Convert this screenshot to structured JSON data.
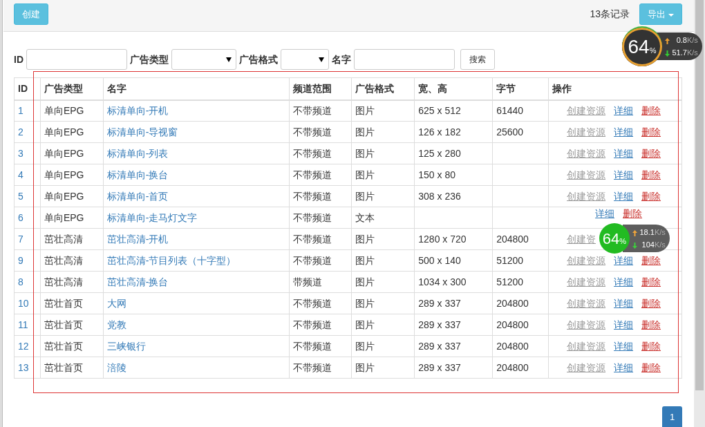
{
  "toolbar": {
    "create_button": "创建",
    "record_count": "13条记录",
    "export_button": "导出"
  },
  "filters": [
    {
      "kind": "text",
      "label": "ID"
    },
    {
      "kind": "select",
      "label": "广告类型"
    },
    {
      "kind": "select",
      "label": "广告格式"
    },
    {
      "kind": "text",
      "label": "名字"
    }
  ],
  "search_button": "搜索",
  "table": {
    "columns": [
      "ID",
      "广告类型",
      "名字",
      "频道范围",
      "广告格式",
      "宽、高",
      "字节",
      "操作"
    ],
    "rows": [
      {
        "id": "1",
        "type": "单向EPG",
        "name": "标清单向-开机",
        "channel": "不带频道",
        "format": "图片",
        "size": "625 x 512",
        "bytes": "61440",
        "actions": [
          {
            "kind": "create",
            "label": "创建资源"
          },
          {
            "kind": "detail",
            "label": "详细"
          },
          {
            "kind": "delete",
            "label": "删除"
          }
        ]
      },
      {
        "id": "2",
        "type": "单向EPG",
        "name": "标清单向-导视窗",
        "channel": "不带频道",
        "format": "图片",
        "size": "126 x 182",
        "bytes": "25600",
        "actions": [
          {
            "kind": "create",
            "label": "创建资源"
          },
          {
            "kind": "detail",
            "label": "详细"
          },
          {
            "kind": "delete",
            "label": "删除"
          }
        ]
      },
      {
        "id": "3",
        "type": "单向EPG",
        "name": "标清单向-列表",
        "channel": "不带频道",
        "format": "图片",
        "size": "125 x 280",
        "actions": [
          {
            "kind": "create",
            "label": "创建资源"
          },
          {
            "kind": "detail",
            "label": "详细"
          },
          {
            "kind": "delete",
            "label": "删除"
          }
        ]
      },
      {
        "id": "4",
        "type": "单向EPG",
        "name": "标清单向-换台",
        "channel": "不带频道",
        "format": "图片",
        "size": "150 x 80",
        "actions": [
          {
            "kind": "create",
            "label": "创建资源"
          },
          {
            "kind": "detail",
            "label": "详细"
          },
          {
            "kind": "delete",
            "label": "删除"
          }
        ]
      },
      {
        "id": "5",
        "type": "单向EPG",
        "name": "标清单向-首页",
        "channel": "不带频道",
        "format": "图片",
        "size": "308 x 236",
        "actions": [
          {
            "kind": "create",
            "label": "创建资源"
          },
          {
            "kind": "detail",
            "label": "详细"
          },
          {
            "kind": "delete",
            "label": "删除"
          }
        ]
      },
      {
        "id": "6",
        "type": "单向EPG",
        "name": "标清单向-走马灯文字",
        "channel": "不带频道",
        "format": "文本",
        "actions": [
          {
            "kind": "detail",
            "label": "详细"
          },
          {
            "kind": "delete",
            "label": "删除"
          }
        ]
      },
      {
        "id": "7",
        "type": "茁壮高清",
        "name": "茁壮高清-开机",
        "channel": "不带频道",
        "format": "图片",
        "size": "1280 x 720",
        "bytes": "204800",
        "actions": [
          {
            "kind": "create",
            "label": "创建资"
          }
        ]
      },
      {
        "id": "9",
        "type": "茁壮高清",
        "name": "茁壮高清-节目列表（十字型）",
        "channel": "不带频道",
        "format": "图片",
        "size": "500 x 140",
        "bytes": "51200",
        "actions": [
          {
            "kind": "create",
            "label": "创建资源"
          },
          {
            "kind": "detail",
            "label": "详细"
          },
          {
            "kind": "delete",
            "label": "删除"
          }
        ]
      },
      {
        "id": "8",
        "type": "茁壮高清",
        "name": "茁壮高清-换台",
        "channel": "带频道",
        "format": "图片",
        "size": "1034 x 300",
        "bytes": "51200",
        "actions": [
          {
            "kind": "create",
            "label": "创建资源"
          },
          {
            "kind": "detail",
            "label": "详细"
          },
          {
            "kind": "delete",
            "label": "删除"
          }
        ]
      },
      {
        "id": "10",
        "type": "茁壮首页",
        "name": "大网",
        "channel": "不带频道",
        "format": "图片",
        "size": "289 x 337",
        "bytes": "204800",
        "actions": [
          {
            "kind": "create",
            "label": "创建资源"
          },
          {
            "kind": "detail",
            "label": "详细"
          },
          {
            "kind": "delete",
            "label": "删除"
          }
        ]
      },
      {
        "id": "11",
        "type": "茁壮首页",
        "name": "党教",
        "channel": "不带频道",
        "format": "图片",
        "size": "289 x 337",
        "bytes": "204800",
        "actions": [
          {
            "kind": "create",
            "label": "创建资源"
          },
          {
            "kind": "detail",
            "label": "详细"
          },
          {
            "kind": "delete",
            "label": "删除"
          }
        ]
      },
      {
        "id": "12",
        "type": "茁壮首页",
        "name": "三峡银行",
        "channel": "不带频道",
        "format": "图片",
        "size": "289 x 337",
        "bytes": "204800",
        "actions": [
          {
            "kind": "create",
            "label": "创建资源"
          },
          {
            "kind": "detail",
            "label": "详细"
          },
          {
            "kind": "delete",
            "label": "删除"
          }
        ]
      },
      {
        "id": "13",
        "type": "茁壮首页",
        "name": "涪陵",
        "channel": "不带频道",
        "format": "图片",
        "size": "289 x 337",
        "bytes": "204800",
        "actions": [
          {
            "kind": "create",
            "label": "创建资源"
          },
          {
            "kind": "detail",
            "label": "详细"
          },
          {
            "kind": "delete",
            "label": "删除"
          }
        ]
      }
    ]
  },
  "pagination": [
    {
      "label": "1",
      "selected": true
    }
  ],
  "net_monitors": [
    {
      "percent": "64",
      "percent_sign": "%",
      "up": "0.8",
      "up_unit": "K/s",
      "down": "51.7",
      "down_unit": "K/s"
    },
    {
      "percent": "64",
      "percent_sign": "%",
      "up": "18.1",
      "up_unit": "K/s",
      "down": "104",
      "down_unit": "K/s"
    }
  ]
}
